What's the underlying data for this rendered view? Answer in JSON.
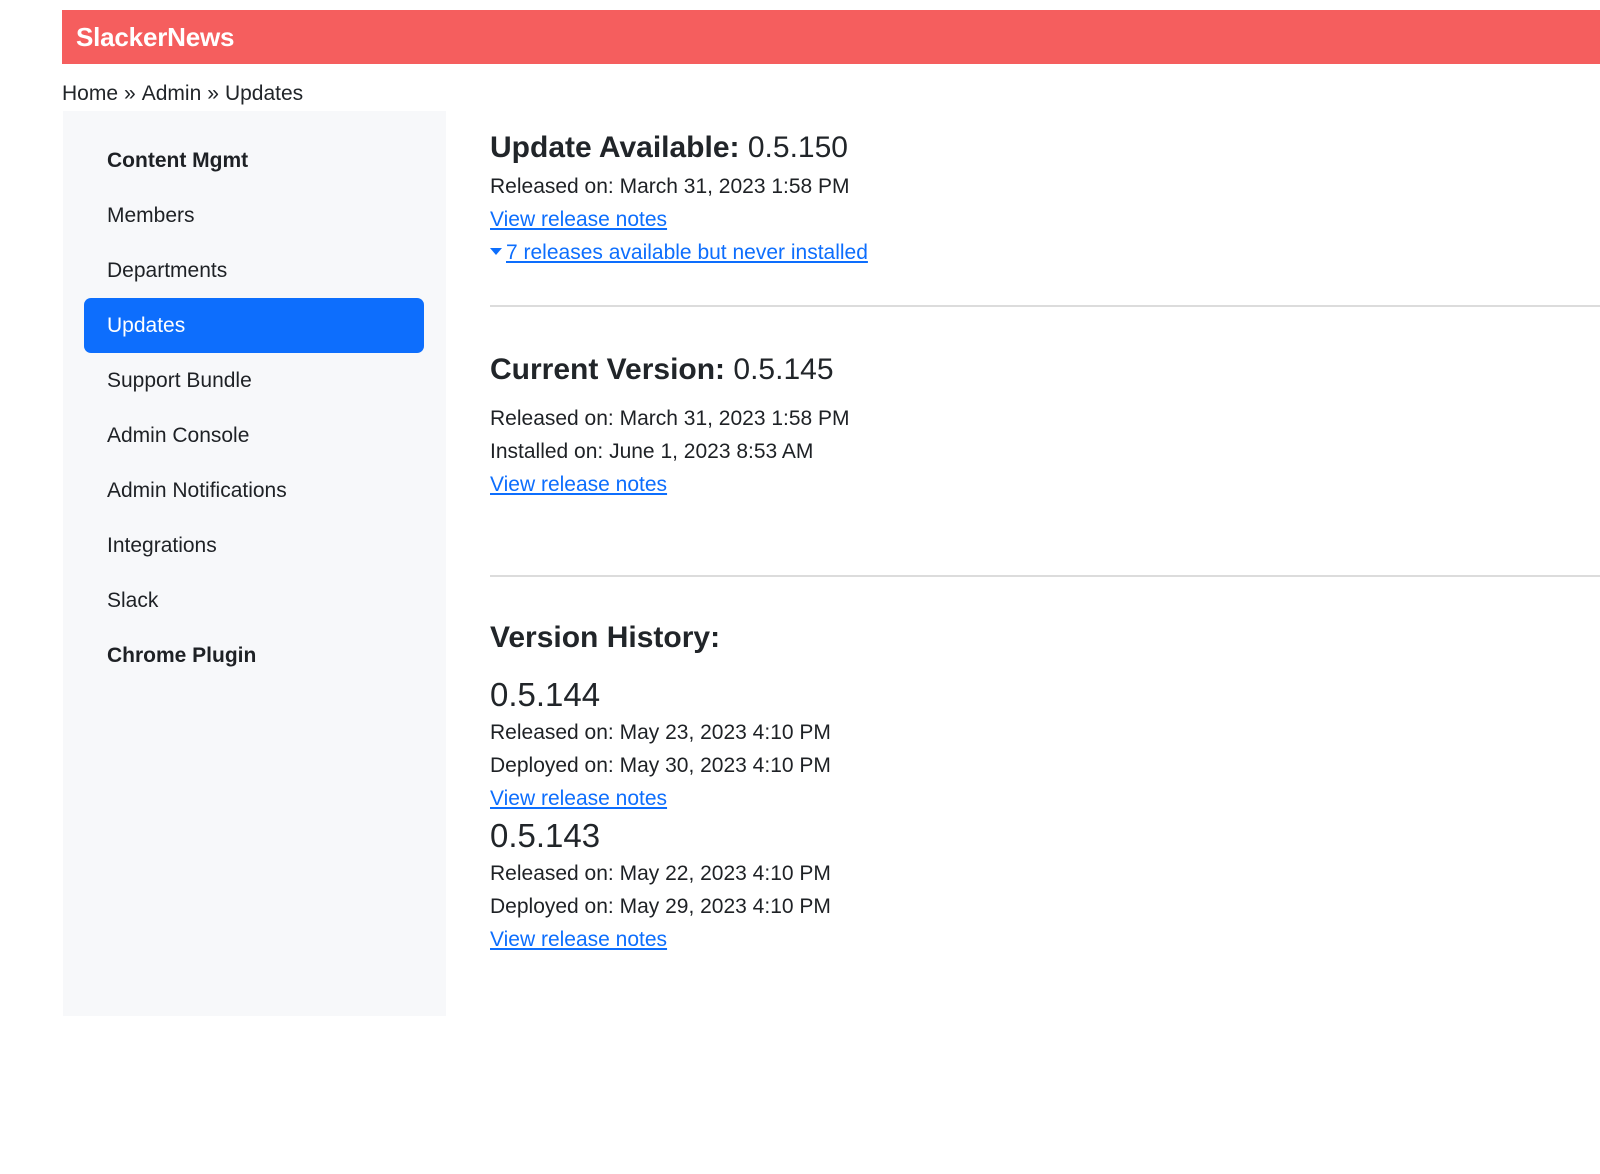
{
  "app": {
    "brand": "SlackerNews",
    "brand_color": "#f55e5e",
    "accent_color": "#0d6efd"
  },
  "breadcrumb": {
    "items": [
      "Home",
      "Admin",
      "Updates"
    ],
    "separator": "»"
  },
  "sidebar": {
    "items": [
      {
        "label": "Content Mgmt"
      },
      {
        "label": "Members"
      },
      {
        "label": "Departments"
      },
      {
        "label": "Updates",
        "active": true
      },
      {
        "label": "Support Bundle"
      },
      {
        "label": "Admin Console"
      },
      {
        "label": "Admin Notifications"
      },
      {
        "label": "Integrations"
      },
      {
        "label": "Slack"
      },
      {
        "label": "Chrome Plugin"
      }
    ]
  },
  "update_available": {
    "label": "Update Available:",
    "version": "0.5.150",
    "released": "Released on: March 31, 2023 1:58 PM",
    "release_notes_link": "View release notes",
    "pending_releases_link": "7 releases available but never installed",
    "pending_icon": "caret-down-icon"
  },
  "current_version": {
    "label": "Current Version:",
    "version": "0.5.145",
    "released": "Released on: March 31, 2023 1:58 PM",
    "installed": "Installed on: June 1, 2023 8:53 AM",
    "release_notes_link": "View release notes"
  },
  "version_history": {
    "title": "Version History:",
    "entries": [
      {
        "version": "0.5.144",
        "released": "Released on: May 23, 2023 4:10 PM",
        "deployed": "Deployed on: May 30, 2023 4:10 PM",
        "release_notes_link": "View release notes"
      },
      {
        "version": "0.5.143",
        "released": "Released on: May 22, 2023 4:10 PM",
        "deployed": "Deployed on: May 29, 2023 4:10 PM",
        "release_notes_link": "View release notes"
      }
    ]
  }
}
